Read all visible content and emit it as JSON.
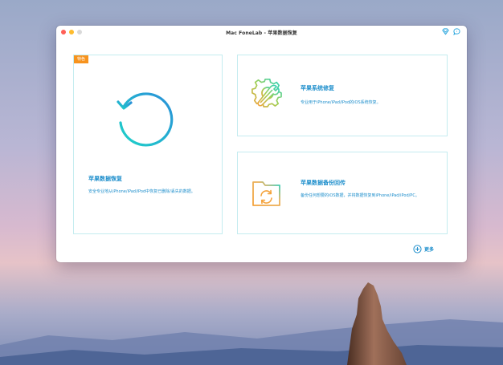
{
  "window": {
    "title": "Mac FoneLab - 苹果数据恢复"
  },
  "cards": {
    "recovery": {
      "badge": "特色",
      "title": "苹果数据恢复",
      "description": "安全专业地从iPhone/iPad/iPod中恢复已删除/丢失的数据。",
      "icon": "restore-plus-icon"
    },
    "repair": {
      "title": "苹果系统修复",
      "description": "专业用于iPhone/iPad/iPod的iOS系统恢复。",
      "icon": "gear-wrench-icon"
    },
    "backup": {
      "title": "苹果数据备份回传",
      "description": "备份任何想要的iOS数据，并将数据恢复到iPhone/iPad/iPod/PC。",
      "icon": "folder-sync-icon"
    }
  },
  "more": {
    "label": "更多",
    "icon": "plus-circle-icon"
  },
  "colors": {
    "accent": "#1f8fcc",
    "badge": "#f7931e",
    "card_border": "#c4ecf0",
    "gradient_teal": "#1ed2c8",
    "gradient_orange": "#f4a33c"
  }
}
